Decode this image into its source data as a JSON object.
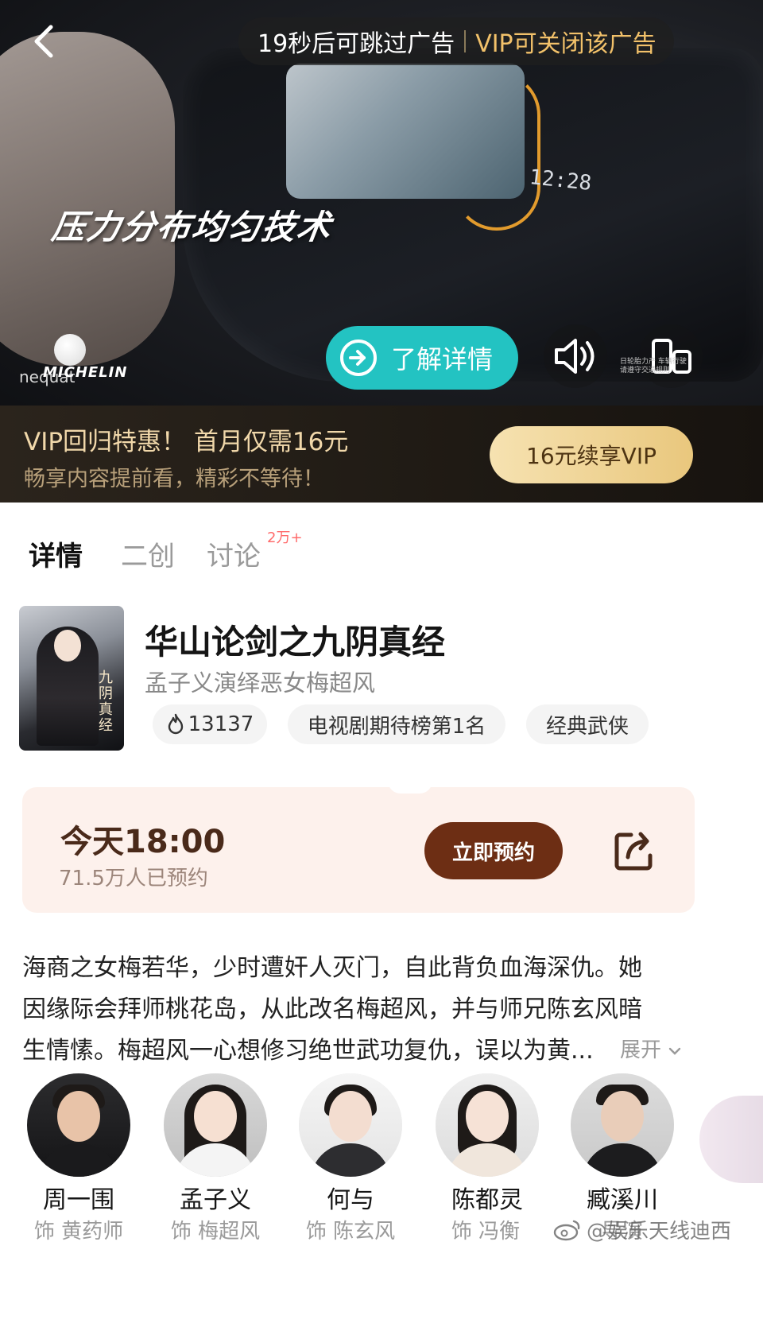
{
  "ad": {
    "countdown_text": "19秒后可跳过广告",
    "vip_close_text": "VIP可关闭该广告",
    "slogan": "压力分布均匀技术",
    "brand": "MICHELIN",
    "sub_brand": "nequat",
    "clock": "12:28",
    "cta_label": "了解详情",
    "mini_text": "日轮胎力产 车辆行驶 请遵守交通规则",
    "icons": [
      "back-arrow",
      "arrow-right-circle",
      "speaker",
      "rotate-screen"
    ]
  },
  "vip_promo": {
    "title": "VIP回归特惠！ 首月仅需16元",
    "subtitle": "畅享内容提前看，精彩不等待！",
    "button_label": "16元续享VIP",
    "accent": "#e9c77d"
  },
  "tabs": [
    {
      "label": "详情",
      "active": true
    },
    {
      "label": "二创",
      "active": false
    },
    {
      "label": "讨论",
      "active": false,
      "badge": "2万+"
    }
  ],
  "drama": {
    "title": "华山论剑之九阴真经",
    "subtitle": "孟子义演绎恶女梅超风",
    "poster_text": "九阴真经",
    "heat": "13137",
    "rank": "电视剧期待榜第1名",
    "genre": "经典武侠"
  },
  "reserve": {
    "time": "今天18:00",
    "count": "71.5万人已预约",
    "button_label": "立即预约",
    "button_color": "#6d2e14"
  },
  "synopsis": {
    "lines": [
      "海商之女梅若华，少时遭奸人灭门，自此背负血海深仇。她",
      "因缘际会拜师桃花岛，从此改名梅超风，并与师兄陈玄风暗",
      "生情愫。梅超风一心想修习绝世武功复仇，误以为黄..."
    ],
    "expand_label": "展开"
  },
  "cast": [
    {
      "name": "周一围",
      "role": "饰 黄药师"
    },
    {
      "name": "孟子义",
      "role": "饰 梅超风"
    },
    {
      "name": "何与",
      "role": "饰 陈玄风"
    },
    {
      "name": "陈都灵",
      "role": "饰 冯衡"
    },
    {
      "name": "臧溪川",
      "role": "导演"
    }
  ],
  "watermark": "@娱乐天线迪西"
}
